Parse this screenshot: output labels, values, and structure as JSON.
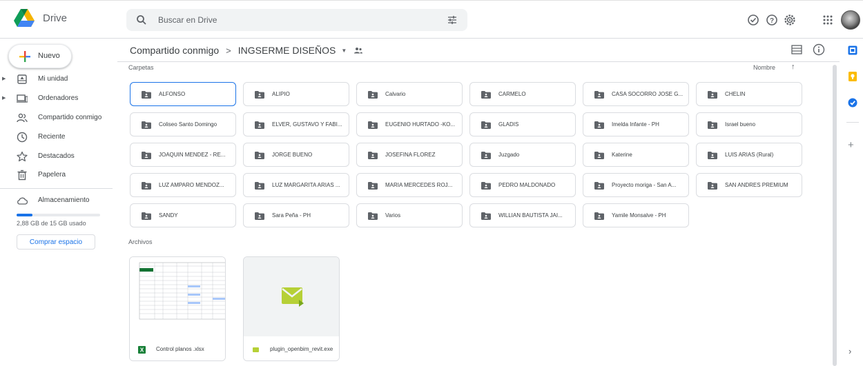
{
  "app": {
    "title": "Drive",
    "brand_colors": {
      "green": "#0f9d58",
      "yellow": "#f4b400",
      "blue": "#4285f4",
      "accent": "#1a73e8"
    }
  },
  "search": {
    "placeholder": "Buscar en Drive",
    "icon": "search-icon",
    "options_icon": "tune-icon"
  },
  "top_icons": [
    "offline-status-icon",
    "help-icon",
    "settings-icon",
    "apps-grid-icon",
    "account-avatar"
  ],
  "sidebar": {
    "new_button": "Nuevo",
    "items": [
      {
        "label": "Mi unidad",
        "icon": "my-drive-icon",
        "expandable": true
      },
      {
        "label": "Ordenadores",
        "icon": "computer-icon",
        "expandable": true
      },
      {
        "label": "Compartido conmigo",
        "icon": "shared-with-me-icon",
        "expandable": false
      },
      {
        "label": "Reciente",
        "icon": "clock-icon",
        "expandable": false
      },
      {
        "label": "Destacados",
        "icon": "star-icon",
        "expandable": false
      },
      {
        "label": "Papelera",
        "icon": "trash-icon",
        "expandable": false
      }
    ],
    "storage": {
      "label": "Almacenamiento",
      "used_text": "2,88 GB de 15 GB usado",
      "used_fraction": 0.19,
      "buy_button": "Comprar espacio"
    }
  },
  "breadcrumb": {
    "root": "Compartido conmigo",
    "current": "INGSERME DISEÑOS"
  },
  "folders_section": {
    "label": "Carpetas",
    "sort_label": "Nombre",
    "sort_direction": "ascending",
    "folders": [
      "ALFONSO",
      "ALIPIO",
      "Calvario",
      "CARMELO",
      "CASA SOCORRO JOSE G...",
      "CHELIN",
      "Coliseo Santo Domingo",
      "ELVER, GUSTAVO Y FABI...",
      "EUGENIO HURTADO -KO...",
      "GLADIS",
      "Imelda Infante - PH",
      "Israel bueno",
      "JOAQUIN MENDEZ - RE...",
      "JORGE BUENO",
      "JOSEFINA FLOREZ",
      "Juzgado",
      "Katerine",
      "LUIS ARIAS (Rural)",
      "LUZ AMPARO MENDOZ...",
      "LUZ MARGARITA ARIAS ...",
      "MARIA MERCEDES ROJ...",
      "PEDRO MALDONADO",
      "Proyecto moriga - San A...",
      "SAN ANDRES PREMIUM",
      "SANDY",
      "Sara Peña - PH",
      "Varios",
      "WILLIAN BAUTISTA JAI...",
      "Yamile Monsalve - PH"
    ],
    "selected_folder": "ALFONSO"
  },
  "files_section": {
    "label": "Archivos",
    "files": [
      {
        "name": "Control planos .xlsx",
        "type_icon": "excel-icon"
      },
      {
        "name": "plugin_openbim_revit.exe",
        "type_icon": "exe-icon"
      }
    ]
  },
  "side_panel": [
    "calendar-icon",
    "keep-icon",
    "tasks-icon"
  ]
}
